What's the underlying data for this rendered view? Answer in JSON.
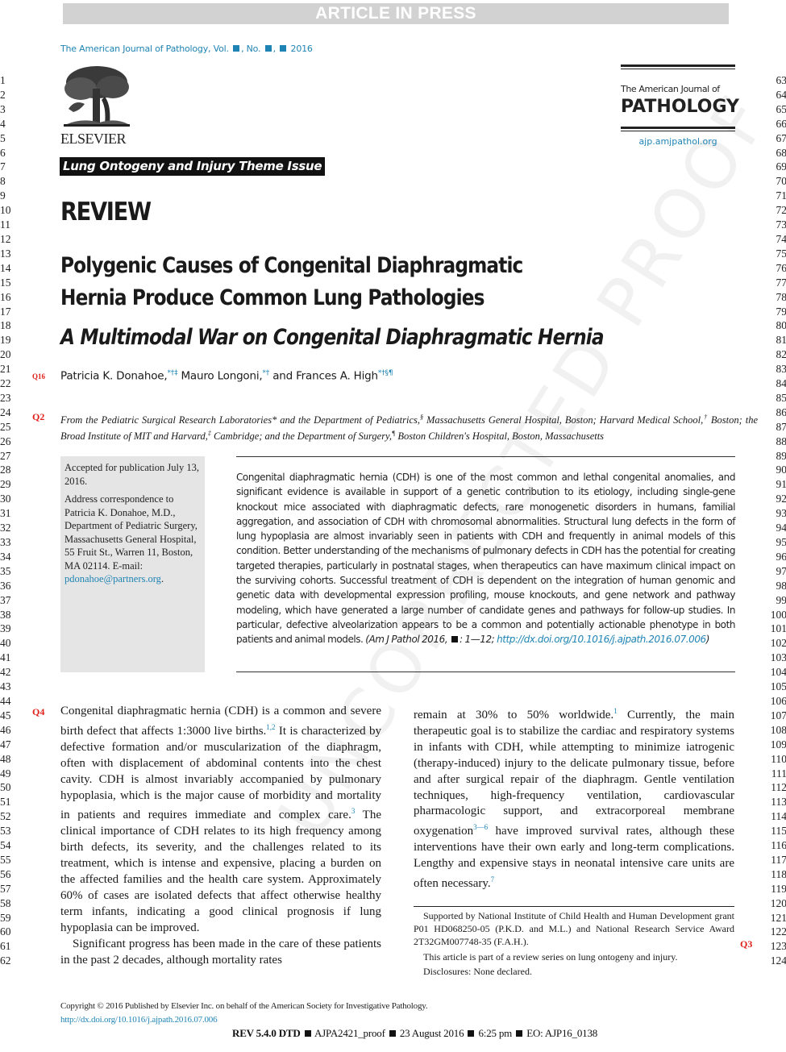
{
  "banner": "ARTICLE IN PRESS",
  "running_head": {
    "journal": "The American Journal of Pathology, Vol.",
    "no_label": ", No.",
    "year": "2016"
  },
  "line_numbers_left": [
    "1",
    "2",
    "3",
    "4",
    "5",
    "6",
    "7",
    "8",
    "9",
    "10",
    "11",
    "12",
    "13",
    "14",
    "15",
    "16",
    "17",
    "18",
    "19",
    "20",
    "21",
    "22",
    "23",
    "24",
    "25",
    "26",
    "27",
    "28",
    "29",
    "30",
    "31",
    "32",
    "33",
    "34",
    "35",
    "36",
    "37",
    "38",
    "39",
    "40",
    "41",
    "42",
    "43",
    "44",
    "45",
    "46",
    "47",
    "48",
    "49",
    "50",
    "51",
    "52",
    "53",
    "54",
    "55",
    "56",
    "57",
    "58",
    "59",
    "60",
    "61",
    "62"
  ],
  "line_numbers_right": [
    "63",
    "64",
    "65",
    "66",
    "67",
    "68",
    "69",
    "70",
    "71",
    "72",
    "73",
    "74",
    "75",
    "76",
    "77",
    "78",
    "79",
    "80",
    "81",
    "82",
    "83",
    "84",
    "85",
    "86",
    "87",
    "88",
    "89",
    "90",
    "91",
    "92",
    "93",
    "94",
    "95",
    "96",
    "97",
    "98",
    "99",
    "100",
    "101",
    "102",
    "103",
    "104",
    "105",
    "106",
    "107",
    "108",
    "109",
    "110",
    "111",
    "112",
    "113",
    "114",
    "115",
    "116",
    "117",
    "118",
    "119",
    "120",
    "121",
    "122",
    "123",
    "124"
  ],
  "publisher": {
    "name": "ELSEVIER"
  },
  "theme_issue": "Lung Ontogeny and Injury Theme Issue",
  "journal_box": {
    "small": "The American Journal of",
    "big": "PATHOLOGY",
    "url": "ajp.amjpathol.org"
  },
  "article_type": "REVIEW",
  "title_lines": [
    "Polygenic Causes of Congenital Diaphragmatic",
    "Hernia Produce Common Lung Pathologies"
  ],
  "subtitle": "A Multimodal War on Congenital Diaphragmatic Hernia",
  "authors": [
    {
      "name": "Patricia K. Donahoe,",
      "marks": "*†‡"
    },
    {
      "name": " Mauro Longoni,",
      "marks": "*†"
    },
    {
      "name": " and Frances A. High",
      "marks": "*†§¶"
    }
  ],
  "query_marks": {
    "q16": "Q16",
    "q2": "Q2",
    "q4": "Q4",
    "q3": "Q3"
  },
  "affiliation": {
    "p1": "From the Pediatric Surgical Research Laboratories* and the Department of Pediatrics,",
    "m1": "§",
    "p2": " Massachusetts General Hospital, Boston; Harvard Medical School,",
    "m2": "†",
    "p3": " Boston; the Broad Institute of MIT and Harvard,",
    "m3": "‡",
    "p4": " Cambridge; and the Department of Surgery,",
    "m4": "¶",
    "p5": " Boston Children's Hospital, Boston, Massachusetts"
  },
  "sidebox": {
    "accepted": "Accepted for publication July 13, 2016.",
    "address": "Address correspondence to Patricia K. Donahoe, M.D., Department of Pediatric Surgery, Massachusetts General Hospital, 55 Fruit St., Warren 11, Boston, MA 02114.  E-mail: ",
    "email": "pdonahoe@partners.org",
    "email_end": "."
  },
  "abstract": {
    "text": "Congenital diaphragmatic hernia (CDH) is one of the most common and lethal congenital anomalies, and significant evidence is available in support of a genetic contribution to its etiology, including single-gene knockout mice associated with diaphragmatic defects, rare monogenetic disorders in humans, familial aggregation, and association of CDH with chromosomal abnormalities. Structural lung defects in the form of lung hypoplasia are almost invariably seen in patients with CDH and frequently in animal models of this condition. Better understanding of the mechanisms of pulmonary defects in CDH has the potential for creating targeted therapies, particularly in postnatal stages, when therapeutics can have maximum clinical impact on the surviving cohorts. Successful treatment of CDH is dependent on the integration of human genomic and genetic data with developmental expression profiling, mouse knockouts, and gene network and pathway modeling, which have generated a large number of candidate genes and pathways for follow-up studies. In particular, defective alveolarization appears to be a common and potentially actionable phenotype in both patients and animal models. ",
    "citation_start": "(Am J Pathol  2016,",
    "citation_pages": ": 1—12; ",
    "doi": "http://dx.doi.org/10.1016/j.ajpath.2016.07.006",
    "citation_end": ")"
  },
  "body_left": {
    "p1a": "Congenital diaphragmatic hernia (CDH) is a common and severe birth defect that affects 1:3000 live births.",
    "ref1": "1,2",
    "p1b": " It is characterized by defective formation and/or muscularization of the diaphragm, often with displacement of abdominal contents into the chest cavity. CDH is almost invariably accompanied by pulmonary hypoplasia, which is the major cause of morbidity and mortality in patients and requires immediate and complex care.",
    "ref2": "3",
    "p1c": " The clinical importance of CDH relates to its high frequency among birth defects, its severity, and the challenges related to its treatment, which is intense and expensive, placing a burden on the affected families and the health care system. Approximately 60% of cases are isolated defects that affect otherwise healthy term infants, indicating a good clinical prognosis if lung hypoplasia can be improved.",
    "p2": "Significant progress has been made in the care of these patients in the past 2 decades, although mortality rates"
  },
  "body_right": {
    "a": "remain at 30% to 50% worldwide.",
    "ref1": "1",
    "b": " Currently, the main therapeutic goal is to stabilize the cardiac and respiratory systems in infants with CDH, while attempting to minimize iatrogenic (therapy-induced) injury to the delicate pulmonary tissue, before and after surgical repair of the diaphragm. Gentle ventilation techniques, high-frequency ventilation, cardiovascular pharmacologic support, and extracorporeal membrane oxygenation",
    "ref2": "3—6",
    "c": " have improved survival rates, although these interventions have their own early and long-term complications. Lengthy and expensive stays in neonatal intensive care units are often necessary.",
    "ref3": "7"
  },
  "footnotes": {
    "support": "Supported by National Institute of Child Health and Human Development grant P01 HD068250-05 (P.K.D. and M.L.) and National Research Service Award 2T32GM007748-35 (F.A.H.).",
    "series": "This article is part of a review series on lung ontogeny and injury.",
    "disclosures": "Disclosures: None declared."
  },
  "footer": {
    "copyright": "Copyright © 2016 Published by Elsevier Inc. on behalf of the American Society for Investigative Pathology.",
    "doi": "http://dx.doi.org/10.1016/j.ajpath.2016.07.006",
    "proof_bold": "REV 5.4.0 DTD",
    "proof_parts": [
      "AJPA2421_proof",
      "23 August 2016",
      "6:25 pm",
      "EO: AJP16_0138"
    ]
  },
  "watermark": "UNCORRECTED PROOF"
}
